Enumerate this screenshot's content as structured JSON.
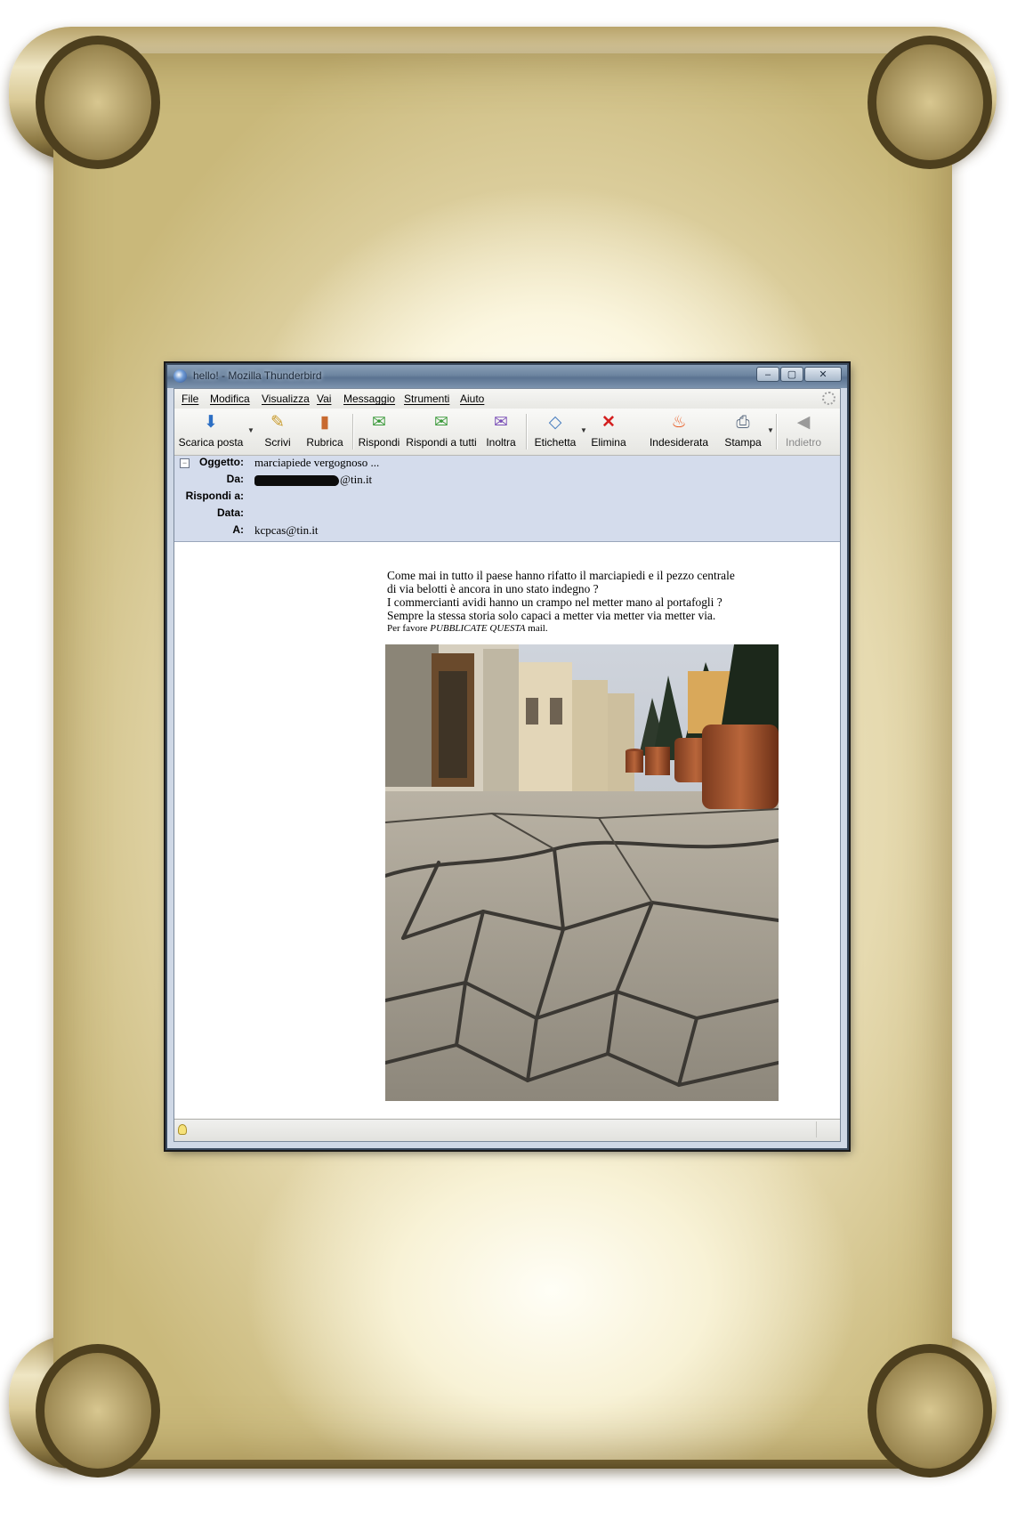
{
  "window": {
    "title": "hello! - Mozilla Thunderbird",
    "controls": {
      "minimize": "–",
      "maximize": "▢",
      "close": "✕"
    }
  },
  "menu": [
    {
      "label": "File"
    },
    {
      "label": "Modifica"
    },
    {
      "label": "Visualizza"
    },
    {
      "label": "Vai"
    },
    {
      "label": "Messaggio"
    },
    {
      "label": "Strumenti"
    },
    {
      "label": "Aiuto"
    }
  ],
  "toolbar": [
    {
      "label": "Scarica posta",
      "icon": "download-mail-icon",
      "glyph": "⬇"
    },
    {
      "label": "Scrivi",
      "icon": "pencil-icon",
      "glyph": "✎"
    },
    {
      "label": "Rubrica",
      "icon": "address-book-icon",
      "glyph": "▮"
    },
    {
      "label": "Rispondi",
      "icon": "reply-icon",
      "glyph": "✉"
    },
    {
      "label": "Rispondi a tutti",
      "icon": "reply-all-icon",
      "glyph": "✉"
    },
    {
      "label": "Inoltra",
      "icon": "forward-icon",
      "glyph": "✉"
    },
    {
      "label": "Etichetta",
      "icon": "tag-icon",
      "glyph": "◇"
    },
    {
      "label": "Elimina",
      "icon": "delete-icon",
      "glyph": "✕"
    },
    {
      "label": "Indesiderata",
      "icon": "junk-flame-icon",
      "glyph": "♨"
    },
    {
      "label": "Stampa",
      "icon": "print-icon",
      "glyph": "⎙"
    },
    {
      "label": "Indietro",
      "icon": "back-arrow-icon",
      "glyph": "◀"
    }
  ],
  "headers": {
    "subject_label": "Oggetto:",
    "subject": "marciapiede  vergognoso ...",
    "from_label": "Da:",
    "from_suffix": "@tin.it",
    "reply_to_label": "Rispondi a:",
    "date_label": "Data:",
    "to_label": "A:",
    "to": "kcpcas@tin.it"
  },
  "message": {
    "line1": "Come mai in tutto il paese  hanno rifatto il marciapiedi e il pezzo centrale",
    "line2": "di via belotti è ancora in uno stato indegno ?",
    "line3": "I commercianti avidi hanno un crampo nel metter mano al portafogli ?",
    "line4": "Sempre la stessa storia solo capaci a metter via  metter  via   metter via.",
    "line5_prefix": "Per favore ",
    "line5_emph": "PUBBLICATE QUESTA",
    "line5_suffix": " mail."
  },
  "colors": {
    "header_bg": "#d4dcec",
    "titlebar": "#6c849f",
    "delete_red": "#d42020",
    "junk_orange": "#e8561c"
  }
}
